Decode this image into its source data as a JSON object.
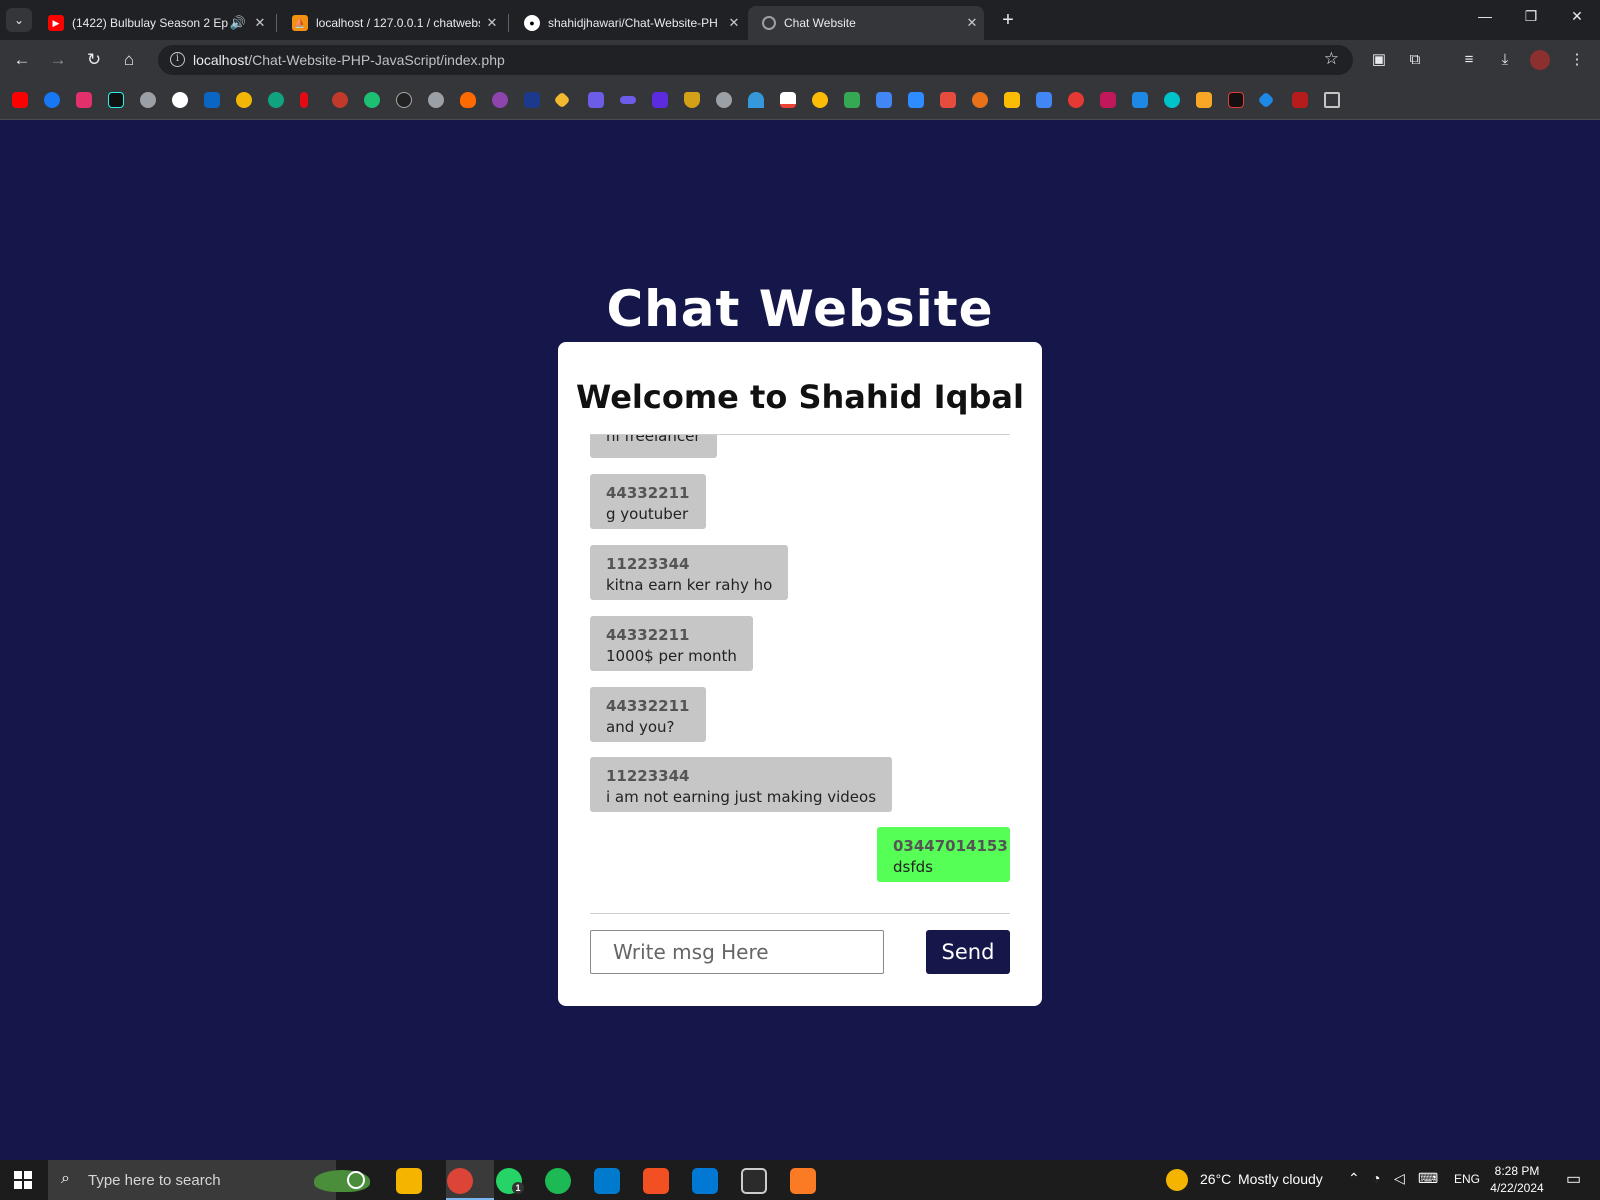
{
  "browser": {
    "tabs": [
      {
        "title": "(1422) Bulbulay Season 2 Ep",
        "favicon": "youtube-icon",
        "color": "#ff0000",
        "playing_audio": true
      },
      {
        "title": "localhost / 127.0.0.1 / chatwebs",
        "favicon": "phpmyadmin-icon",
        "color": "#f29111"
      },
      {
        "title": "shahidjhawari/Chat-Website-PH",
        "favicon": "github-icon",
        "color": "#ffffff"
      },
      {
        "title": "Chat Website",
        "favicon": "globe-icon",
        "color": "#9aa0a6",
        "active": true
      }
    ],
    "url_host": "localhost",
    "url_path": "/Chat-Website-PHP-JavaScript/index.php",
    "bookmark_icons": [
      "youtube",
      "facebook",
      "instagram",
      "tiktok",
      "globe",
      "github",
      "linkedin",
      "bee",
      "openai",
      "netflix",
      "76",
      "fiverr",
      "sketch",
      "globe",
      "fire",
      "upwork",
      "wu",
      "binance",
      "hashnode",
      "infinity",
      "k",
      "shield",
      "globe",
      "person",
      "gmail",
      "pinwheel",
      "drive",
      "pencil",
      "flag",
      "image",
      "circle",
      "keep",
      "translate",
      "refresh",
      "photo",
      "malwarebytes",
      "canva",
      "card",
      "triangle",
      "gem",
      "gallery",
      "folder"
    ]
  },
  "page": {
    "site_title": "Chat Website",
    "welcome": "Welcome to Shahid Iqbal",
    "messages": [
      {
        "sender": "",
        "text": "hi freelancer",
        "mine": false,
        "partial": true
      },
      {
        "sender": "44332211",
        "text": "g youtuber",
        "mine": false
      },
      {
        "sender": "11223344",
        "text": "kitna earn ker rahy ho",
        "mine": false
      },
      {
        "sender": "44332211",
        "text": "1000$ per month",
        "mine": false
      },
      {
        "sender": "44332211",
        "text": "and you?",
        "mine": false
      },
      {
        "sender": "11223344",
        "text": "i am not earning just making videos",
        "mine": false
      },
      {
        "sender": "03447014153",
        "text": "dsfds",
        "mine": true
      }
    ],
    "input_placeholder": "Write msg Here",
    "send_label": "Send"
  },
  "taskbar": {
    "search_placeholder": "Type here to search",
    "weather_temp": "26°C",
    "weather_desc": "Mostly cloudy",
    "language": "ENG",
    "time": "8:28 PM",
    "date": "4/22/2024",
    "whatsapp_badge": "1"
  },
  "colors": {
    "page_bg": "#15174a",
    "my_message": "#55ff55",
    "other_message": "#c6c6c6",
    "send_button": "#15174a"
  }
}
